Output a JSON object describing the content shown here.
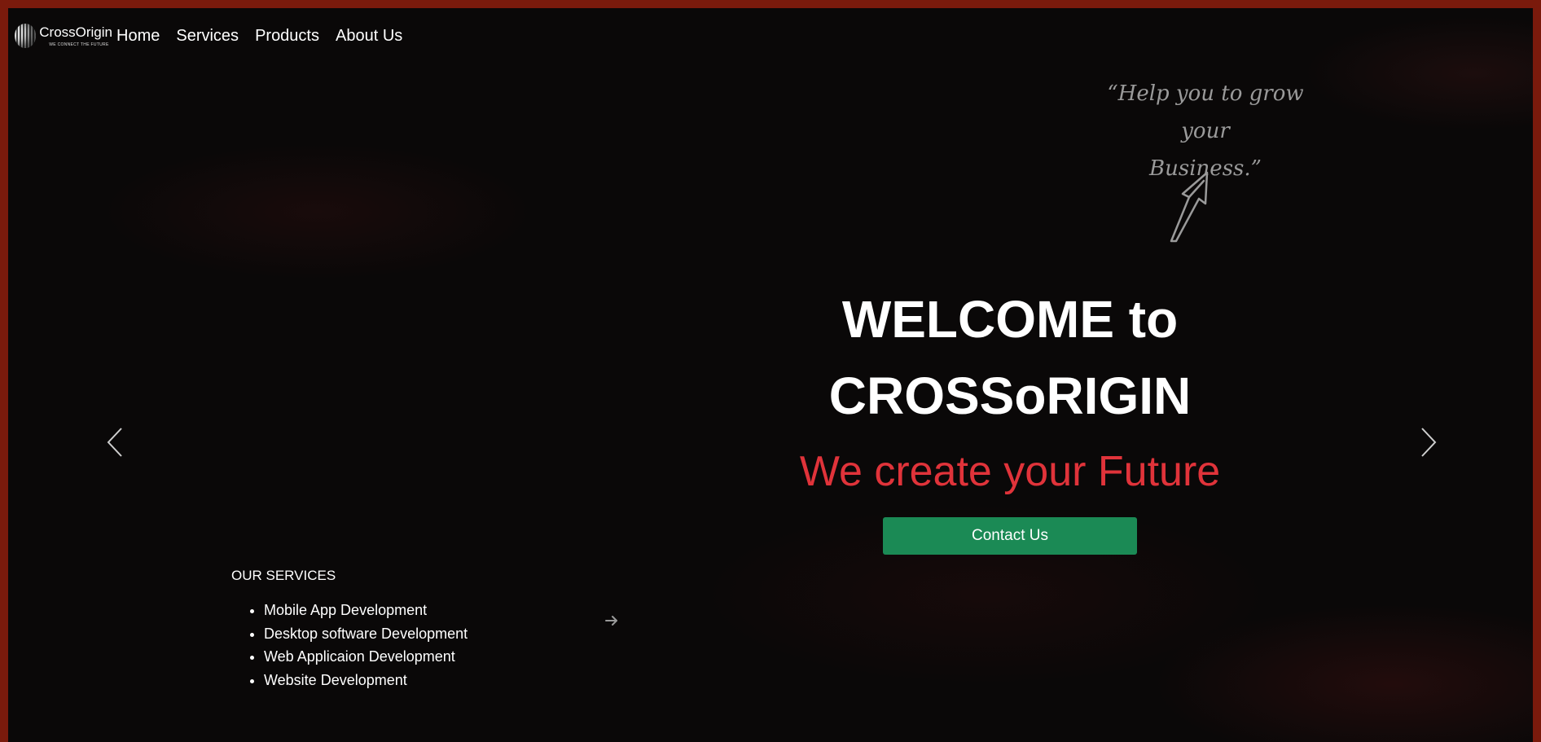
{
  "nav": {
    "logo": {
      "name": "CrossOrigin",
      "tagline": "WE CONNECT THE FUTURE"
    },
    "links": [
      "Home",
      "Services",
      "Products",
      "About Us"
    ]
  },
  "quote": {
    "line1": "“Help you to grow your",
    "line2": "Business.”"
  },
  "hero": {
    "title_line1": "WELCOME to",
    "title_line2": "CROSSoRIGIN",
    "subtitle": "We create your Future",
    "cta_label": "Contact Us"
  },
  "services": {
    "heading": "OUR SERVICES",
    "items": [
      "Mobile App Development",
      "Desktop software Development",
      "Web Applicaion Development",
      "Website Development"
    ]
  },
  "icons": {
    "prev": "chevron-left-icon",
    "next": "chevron-right-icon",
    "small_arrow": "arrow-right-icon",
    "sketch_arrow": "arrow-up-right-icon"
  },
  "colors": {
    "frame_border": "#7a1a0c",
    "background": "#0a0808",
    "accent_red": "#e0333a",
    "cta_green": "#1b8a55"
  }
}
